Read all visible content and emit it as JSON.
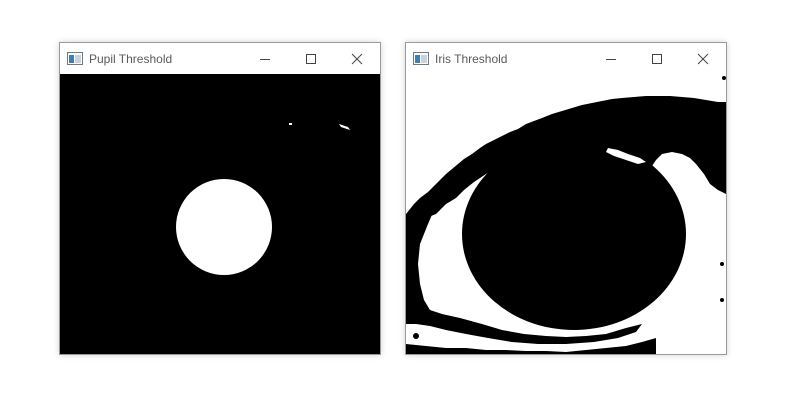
{
  "windows": [
    {
      "title": "Pupil Threshold",
      "controls": {
        "minimize": "minimize",
        "maximize": "maximize",
        "close": "close"
      },
      "image": {
        "description_colors": {
          "foreground": "#ffffff",
          "background": "#000000"
        }
      }
    },
    {
      "title": "Iris Threshold",
      "controls": {
        "minimize": "minimize",
        "maximize": "maximize",
        "close": "close"
      },
      "image": {
        "description_colors": {
          "foreground": "#000000",
          "background": "#ffffff"
        }
      }
    }
  ],
  "icons": {
    "app": "opencv-window-icon",
    "minimize": "minimize-icon",
    "maximize": "maximize-icon",
    "close": "close-icon"
  }
}
